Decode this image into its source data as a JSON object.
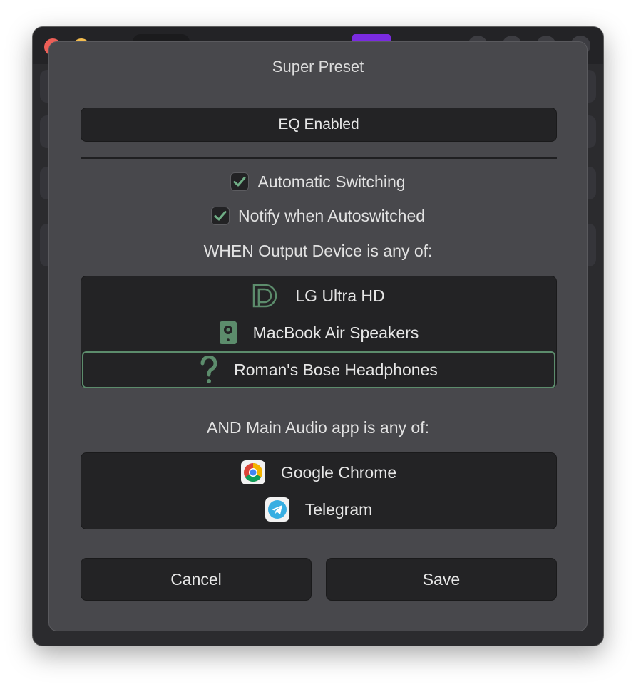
{
  "dialog": {
    "title": "Super Preset",
    "eq_button_label": "EQ Enabled",
    "automatic_switching": {
      "label": "Automatic Switching",
      "checked": true
    },
    "notify_autoswitched": {
      "label": "Notify when Autoswitched",
      "checked": true
    },
    "output_section_label": "WHEN Output Device is any of:",
    "output_devices": [
      {
        "label": "LG Ultra HD",
        "icon": "display-port-icon",
        "selected": false
      },
      {
        "label": "MacBook Air Speakers",
        "icon": "speaker-icon",
        "selected": false
      },
      {
        "label": "Roman's Bose Headphones",
        "icon": "question-mark-icon",
        "selected": true
      }
    ],
    "apps_section_label": "AND Main Audio app is any of:",
    "apps": [
      {
        "label": "Google Chrome",
        "icon": "chrome-icon"
      },
      {
        "label": "Telegram",
        "icon": "telegram-icon"
      }
    ],
    "cancel_label": "Cancel",
    "save_label": "Save"
  },
  "colors": {
    "accent_green": "#5c8c6c",
    "sheet_bg": "#48484c",
    "control_bg": "#232325"
  }
}
